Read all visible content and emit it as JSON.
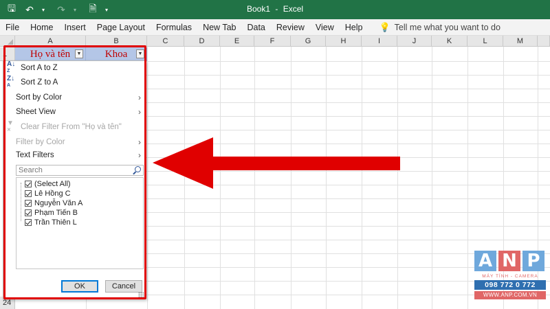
{
  "window": {
    "title": "Book1",
    "separator": "-",
    "app": "Excel"
  },
  "colors": {
    "titlebar": "#217346",
    "header_fill": "#b4c6e7",
    "header_text": "#c00000",
    "annotation": "#e00000"
  },
  "qat_icons": [
    "autosave-icon",
    "undo-icon",
    "redo-icon",
    "document-icon",
    "customize-icon"
  ],
  "menu": {
    "items": [
      "File",
      "Home",
      "Insert",
      "Page Layout",
      "Formulas",
      "New Tab",
      "Data",
      "Review",
      "View",
      "Help"
    ],
    "tell_me": "Tell me what you want to do"
  },
  "sheet": {
    "columns": [
      "A",
      "B",
      "C",
      "D",
      "E",
      "F",
      "G",
      "H",
      "I",
      "J",
      "K",
      "L",
      "M"
    ],
    "row1_label": "1",
    "last_row_label": "24",
    "header_cells": [
      "Họ và tên",
      "Khoa"
    ]
  },
  "filter_menu": {
    "sort_az": "Sort A to Z",
    "sort_za": "Sort Z to A",
    "sort_by_color": "Sort by Color",
    "sheet_view": "Sheet View",
    "clear_filter": "Clear Filter From \"Họ và tên\"",
    "filter_by_color": "Filter by Color",
    "text_filters": "Text Filters",
    "search_placeholder": "Search",
    "values": [
      {
        "label": "(Select All)",
        "checked": true
      },
      {
        "label": "Lê Hồng C",
        "checked": true
      },
      {
        "label": "Nguyễn Văn A",
        "checked": true
      },
      {
        "label": "Phạm Tiến B",
        "checked": true
      },
      {
        "label": "Trần Thiên L",
        "checked": true
      }
    ],
    "ok": "OK",
    "cancel": "Cancel"
  },
  "logo": {
    "letters": [
      "A",
      "N",
      "P"
    ],
    "tagline": "MÁY TÍNH - CAMERA",
    "phone": "098 772 0 772",
    "website": "WWW.ANP.COM.VN"
  }
}
